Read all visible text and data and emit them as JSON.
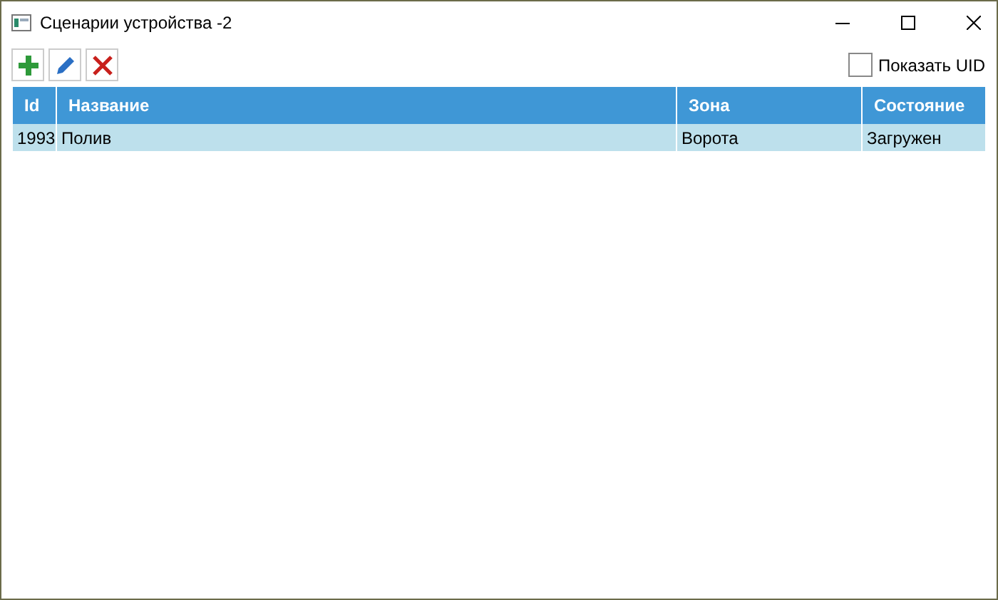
{
  "window": {
    "title": "Сценарии устройства -2"
  },
  "toolbar": {
    "buttons": [
      {
        "kind": "add"
      },
      {
        "kind": "edit"
      },
      {
        "kind": "delete"
      }
    ],
    "show_uid": {
      "label": "Показать UID",
      "checked": false
    }
  },
  "table": {
    "columns": [
      "Id",
      "Название",
      "Зона",
      "Состояние"
    ],
    "rows": [
      {
        "cells": [
          "1993",
          "Полив",
          "Ворота",
          "Загружен"
        ],
        "selected": true
      }
    ]
  }
}
